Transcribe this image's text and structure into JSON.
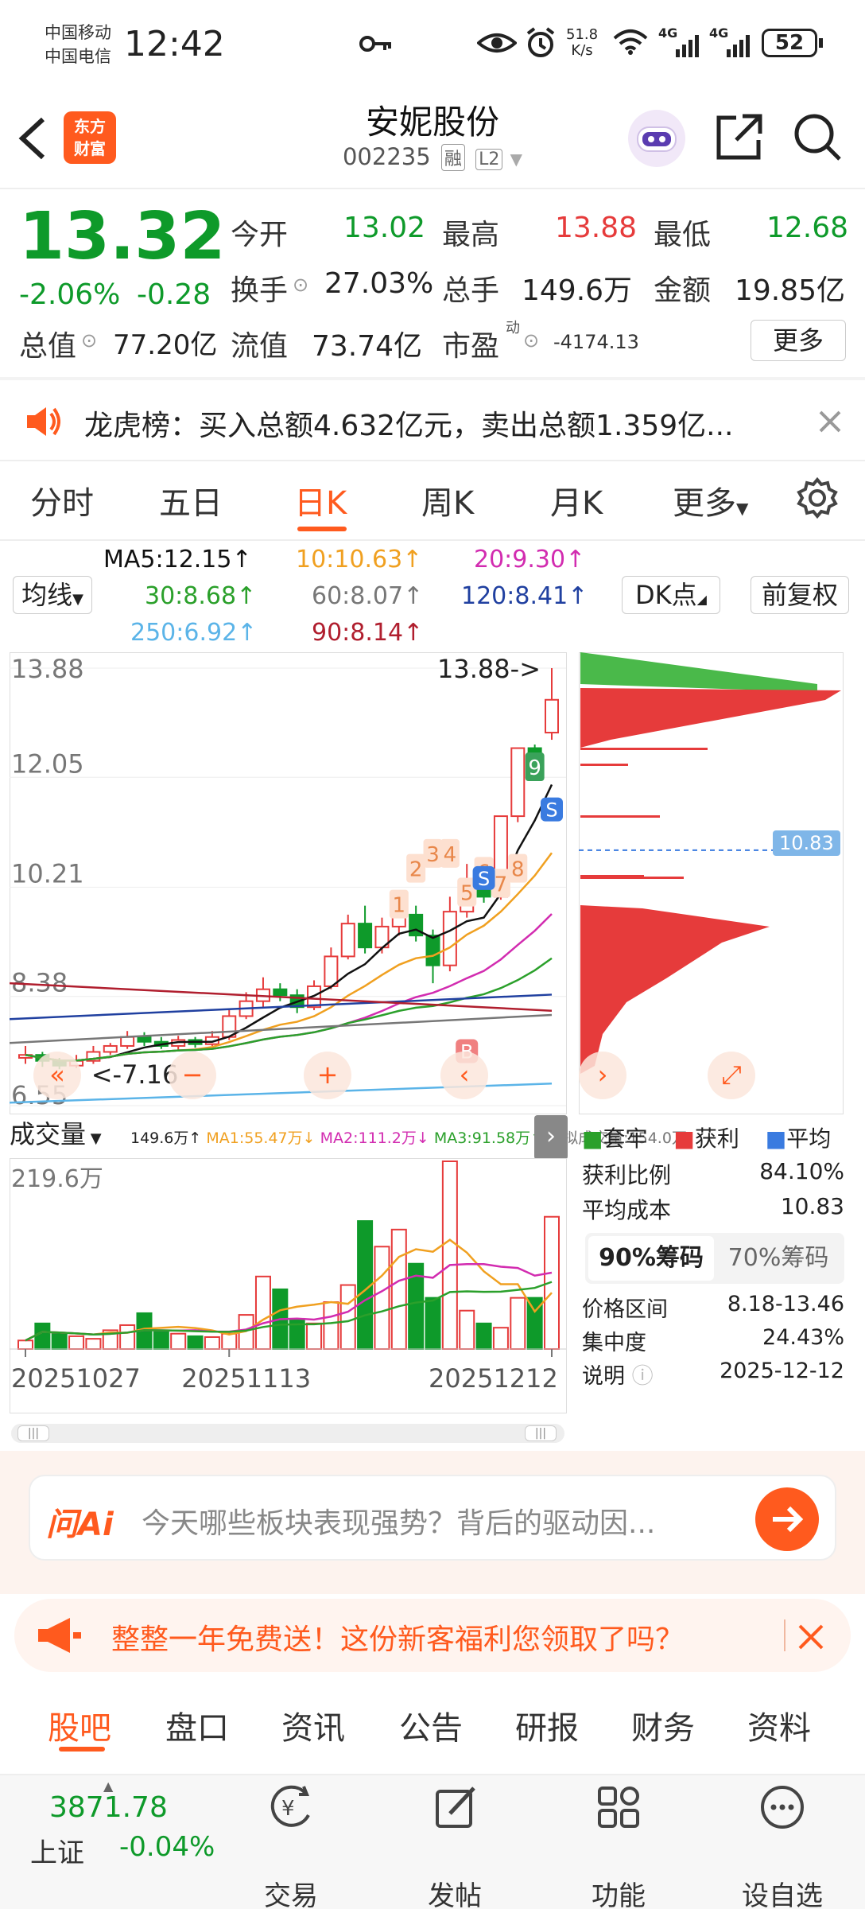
{
  "status_bar": {
    "operator1": "中国移动",
    "operator2": "中国电信",
    "time": "12:42",
    "net_speed_value": "51.8",
    "net_speed_unit": "K/s",
    "signal1": "4G",
    "signal2": "4G",
    "battery": "52"
  },
  "header": {
    "logo_line1": "东方",
    "logo_line2": "财富",
    "title": "安妮股份",
    "code": "002235",
    "tag1": "融",
    "tag2": "L2"
  },
  "quote": {
    "price": "13.32",
    "change_pct": "-2.06%",
    "change": "-0.28",
    "open_label": "今开",
    "open": "13.02",
    "high_label": "最高",
    "high": "13.88",
    "low_label": "最低",
    "low": "12.68",
    "turnover_label": "换手",
    "turnover": "27.03%",
    "volume_label": "总手",
    "volume": "149.6万",
    "amount_label": "金额",
    "amount": "19.85亿",
    "mktcap_label": "总值",
    "mktcap": "77.20亿",
    "float_label": "流值",
    "float": "73.74亿",
    "pe_label": "市盈",
    "pe_sup": "动",
    "pe": "-4174.13",
    "more": "更多"
  },
  "notice": {
    "text": "龙虎榜：买入总额4.632亿元，卖出总额1.359亿..."
  },
  "tabs": [
    "分时",
    "五日",
    "日K",
    "周K",
    "月K",
    "更多"
  ],
  "active_tab": 2,
  "ma": {
    "selector": "均线",
    "ma5": "MA5:12.15↑",
    "ma10": "10:10.63↑",
    "ma20": "20:9.30↑",
    "ma30": "30:8.68↑",
    "ma60": "60:8.07↑",
    "ma120": "120:8.41↑",
    "ma250": "250:6.92↑",
    "ma90": "90:8.14↑",
    "dk": "DK点",
    "adjust": "前复权"
  },
  "colors": {
    "up": "#e63b3b",
    "down": "#0e9a2a",
    "accent": "#ff5a1e",
    "ma5": "#111111",
    "ma10": "#f0a020",
    "ma20": "#d22cb0",
    "ma30": "#2ba02b",
    "ma60": "#777777",
    "ma120": "#2040a0",
    "ma250": "#5bb4e8",
    "ma90": "#b01e2e"
  },
  "chart_data": [
    {
      "type": "candlestick",
      "y_tick_labels": [
        "13.88",
        "12.05",
        "10.21",
        "8.38",
        "6.55"
      ],
      "ylim": [
        6.55,
        13.88
      ],
      "max_marker": "13.88->",
      "min_marker": "<-7.16",
      "signal_labels": [
        "1",
        "2",
        "3",
        "4",
        "5",
        "6",
        "7",
        "8",
        "9"
      ],
      "buy_marker": "B",
      "sell_marker": "S",
      "candles": [
        {
          "o": 7.35,
          "c": 7.4,
          "h": 7.55,
          "l": 7.25
        },
        {
          "o": 7.4,
          "c": 7.3,
          "h": 7.45,
          "l": 7.2
        },
        {
          "o": 7.3,
          "c": 7.22,
          "h": 7.35,
          "l": 7.16
        },
        {
          "o": 7.22,
          "c": 7.3,
          "h": 7.4,
          "l": 7.18
        },
        {
          "o": 7.3,
          "c": 7.45,
          "h": 7.55,
          "l": 7.25
        },
        {
          "o": 7.45,
          "c": 7.55,
          "h": 7.6,
          "l": 7.4
        },
        {
          "o": 7.55,
          "c": 7.7,
          "h": 7.8,
          "l": 7.5
        },
        {
          "o": 7.7,
          "c": 7.62,
          "h": 7.78,
          "l": 7.55
        },
        {
          "o": 7.62,
          "c": 7.55,
          "h": 7.7,
          "l": 7.5
        },
        {
          "o": 7.55,
          "c": 7.65,
          "h": 7.72,
          "l": 7.48
        },
        {
          "o": 7.65,
          "c": 7.58,
          "h": 7.7,
          "l": 7.52
        },
        {
          "o": 7.58,
          "c": 7.7,
          "h": 7.8,
          "l": 7.55
        },
        {
          "o": 7.7,
          "c": 8.05,
          "h": 8.15,
          "l": 7.65
        },
        {
          "o": 8.05,
          "c": 8.3,
          "h": 8.45,
          "l": 8.0
        },
        {
          "o": 8.3,
          "c": 8.5,
          "h": 8.7,
          "l": 8.2
        },
        {
          "o": 8.5,
          "c": 8.4,
          "h": 8.6,
          "l": 8.3
        },
        {
          "o": 8.4,
          "c": 8.2,
          "h": 8.5,
          "l": 8.1
        },
        {
          "o": 8.2,
          "c": 8.55,
          "h": 8.65,
          "l": 8.15
        },
        {
          "o": 8.55,
          "c": 9.05,
          "h": 9.2,
          "l": 8.5
        },
        {
          "o": 9.05,
          "c": 9.6,
          "h": 9.75,
          "l": 9.0
        },
        {
          "o": 9.6,
          "c": 9.2,
          "h": 9.9,
          "l": 9.1
        },
        {
          "o": 9.2,
          "c": 9.55,
          "h": 9.7,
          "l": 9.1
        },
        {
          "o": 9.55,
          "c": 9.75,
          "h": 10.0,
          "l": 9.4
        },
        {
          "o": 9.75,
          "c": 9.4,
          "h": 9.9,
          "l": 9.3
        },
        {
          "o": 9.4,
          "c": 8.9,
          "h": 9.5,
          "l": 8.6
        },
        {
          "o": 8.9,
          "c": 9.8,
          "h": 10.05,
          "l": 8.8
        },
        {
          "o": 9.8,
          "c": 10.35,
          "h": 10.6,
          "l": 9.7
        },
        {
          "o": 10.35,
          "c": 10.05,
          "h": 10.5,
          "l": 9.95
        },
        {
          "o": 10.05,
          "c": 11.4,
          "h": 11.4,
          "l": 10.0
        },
        {
          "o": 11.4,
          "c": 12.54,
          "h": 12.54,
          "l": 11.3
        },
        {
          "o": 12.54,
          "c": 12.3,
          "h": 12.6,
          "l": 12.0
        },
        {
          "o": 12.8,
          "c": 13.35,
          "h": 13.88,
          "l": 12.68
        }
      ]
    },
    {
      "type": "bar",
      "title": "成交量",
      "total": "149.6万↑",
      "ma1": "MA1:55.47万↓",
      "ma2": "MA2:111.2万↓",
      "ma3": "MA3:91.58万↑",
      "virtual": "虚拟成交量:154.0万",
      "y_max_label": "219.6万",
      "x_labels": [
        "20251027",
        "20251113",
        "20251212"
      ],
      "values": [
        10,
        30,
        18,
        15,
        12,
        22,
        28,
        42,
        20,
        18,
        15,
        14,
        18,
        40,
        85,
        70,
        35,
        30,
        55,
        75,
        150,
        120,
        140,
        100,
        60,
        220,
        45,
        30,
        25,
        60,
        60,
        155
      ]
    }
  ],
  "distribution": {
    "avg_cost_marker": "10.83",
    "legend_trap": "套牢",
    "legend_profit": "获利",
    "legend_avg": "平均",
    "profit_ratio_label": "获利比例",
    "profit_ratio": "84.10%",
    "avg_cost_label": "平均成本",
    "avg_cost": "10.83",
    "tab90": "90%筹码",
    "tab70": "70%筹码",
    "range_label": "价格区间",
    "range": "8.18-13.46",
    "concentration_label": "集中度",
    "concentration": "24.43%",
    "desc_label": "说明",
    "desc": "2025-12-12"
  },
  "ai": {
    "brand": "问Ai",
    "placeholder": "今天哪些板块表现强势？背后的驱动因..."
  },
  "promo": {
    "text": "整整一年免费送！这份新客福利您领取了吗？"
  },
  "bottom_tabs": [
    "股吧",
    "盘口",
    "资讯",
    "公告",
    "研报",
    "财务",
    "资料"
  ],
  "footer": {
    "index_value": "3871.78",
    "index_name": "上证",
    "index_change": "-0.04%",
    "trade": "交易",
    "post": "发帖",
    "func": "功能",
    "watch": "设自选"
  }
}
